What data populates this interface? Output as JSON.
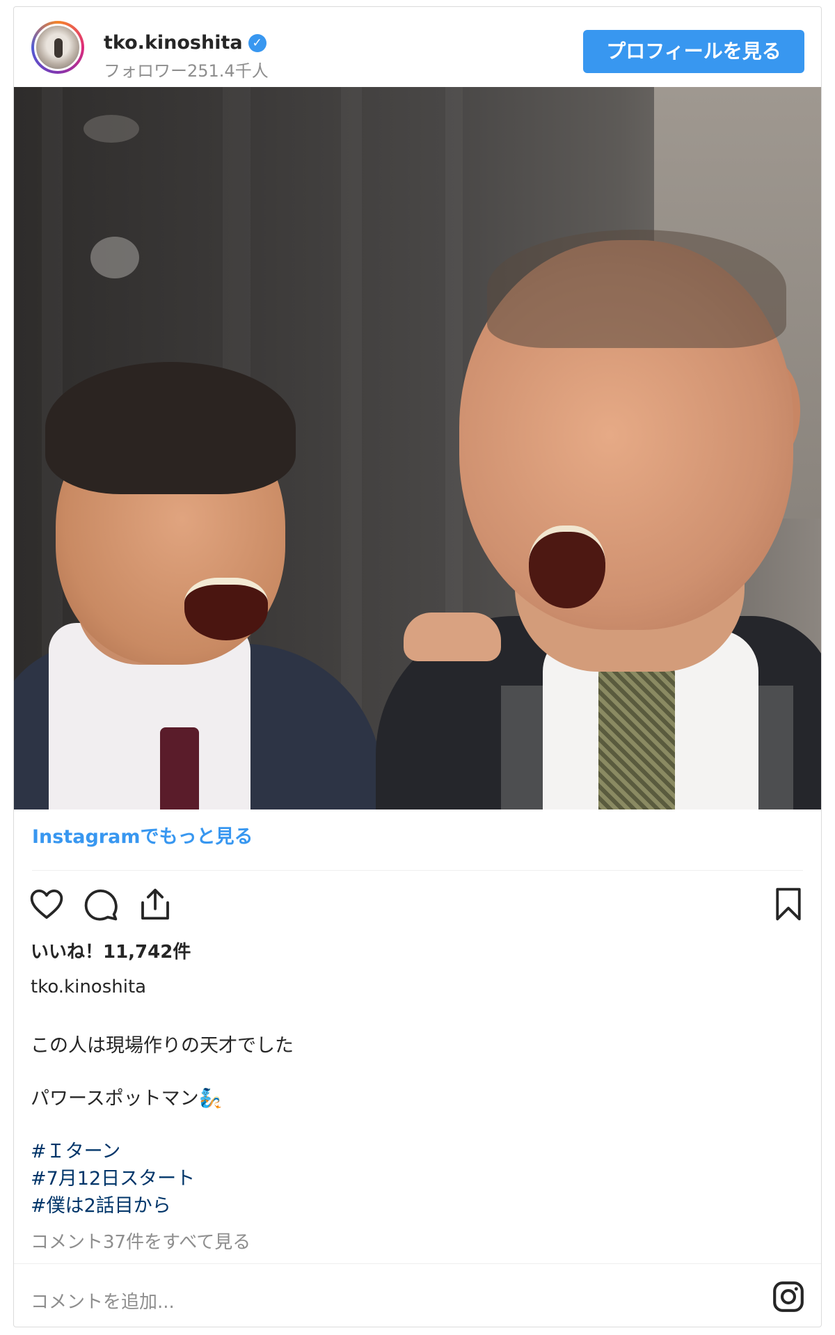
{
  "header": {
    "username": "tko.kinoshita",
    "verified_icon": "verified-badge-icon",
    "followers": "フォロワー251.4千人",
    "profile_button": "プロフィールを見る"
  },
  "post": {
    "more_link": "Instagramでもっと見る",
    "likes": "いいね！11,742件",
    "caption_user": "tko.kinoshita",
    "caption_lines": [
      "この人は現場作りの天才でした",
      "パワースポットマン🧞"
    ],
    "hashtags": [
      "#Ｉターン",
      "#7月12日スタート",
      "#僕は2話目から"
    ],
    "comments_link": "コメント37件をすべて見る"
  },
  "footer": {
    "comment_placeholder": "コメントを追加..."
  },
  "colors": {
    "accent": "#3897f0",
    "hashtag": "#003569",
    "muted": "#8e8e8e"
  }
}
